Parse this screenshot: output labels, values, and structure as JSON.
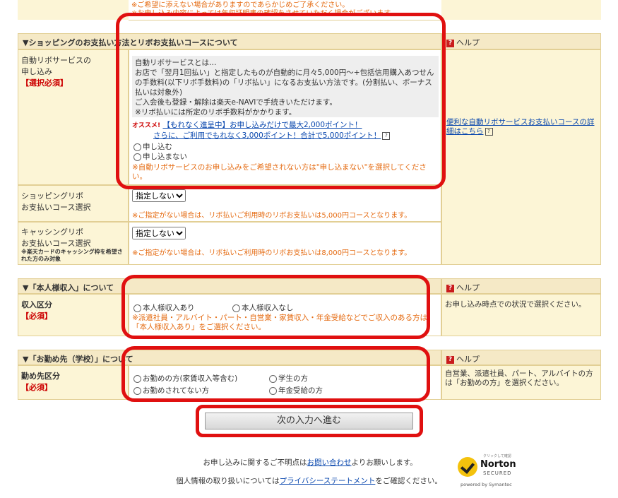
{
  "top_notes": [
    "※ご希望に添えない場合がありますのであらかじめご了承ください。",
    "※お申し込み内容によっては年収証明書の確認をさせていただく場合がございます。"
  ],
  "revo": {
    "header": "▼ショッピングのお支払い方法とリボお支払いコースについて",
    "help_label": "ヘルプ",
    "help_link": "便利な自動リボサービスお支払いコースの詳細はこちら",
    "auto_label_line1": "自動リボサービスの",
    "auto_label_line2": "申し込み",
    "auto_required": "【選択必須】",
    "desc1": "自動リボサービスとは…",
    "desc2": "お店で「翌月1回払い」と指定したものが自動的に月々5,000円～+包括信用購入あつせんの手数料(以下リボ手数料)の「リボ払い」になるお支払い方法です。(分割払い、ボーナス払いは対象外)",
    "desc3": "ご入会後も登録・解除は楽天e-NAVIで手続きいただけます。",
    "desc4": "※リボ払いには所定のリボ手数料がかかります。",
    "osusume": "オススメ!",
    "promo1": "【もれなく進呈中】お申し込みだけで最大2,000ポイント！",
    "promo2": "さらに、ご利用でもれなく3,000ポイント！合計で5,000ポイント！",
    "opt_yes": "申し込む",
    "opt_no": "申し込まない",
    "auto_note": "※自動リボサービスのお申し込みをご希望されない方は\"申し込まない\"を選択してください。",
    "shop_label_line1": "ショッピングリボ",
    "shop_label_line2": "お支払いコース選択",
    "shop_select": "指定しない",
    "shop_note": "※ご指定がない場合は、リボ払いご利用時のリボお支払いは5,000円コースとなります。",
    "cash_label_line1": "キャッシングリボ",
    "cash_label_line2": "お支払いコース選択",
    "cash_small": "※楽天カードのキャッシング枠を希望された方のみ対象",
    "cash_select": "指定しない",
    "cash_note": "※ご指定がない場合は、リボ払いご利用時のリボお支払いは8,000円コースとなります。"
  },
  "income": {
    "header": "▼「本人様収入」について",
    "help_label": "ヘルプ",
    "help_text": "お申し込み時点での状況で選択ください。",
    "label": "収入区分",
    "required": "【必須】",
    "opt1": "本人様収入あり",
    "opt2": "本人様収入なし",
    "note": "※派遣社員・アルバイト・パート・自営業・家賃収入・年金受給などでご収入のある方は「本人様収入あり」をご選択ください。"
  },
  "work": {
    "header": "▼「お勤め先（学校）」について",
    "help_label": "ヘルプ",
    "help_text": "自営業、派遣社員、パート、アルバイトの方は「お勤めの方」を選択ください。",
    "label": "勤め先区分",
    "required": "【必須】",
    "opt1": "お勤めの方(家賃収入等含む)",
    "opt2": "学生の方",
    "opt3": "お勤めされてない方",
    "opt4": "年金受給の方"
  },
  "next_button": "次の入力へ進む",
  "footer": {
    "line1_pre": "お申し込みに関するご不明点は",
    "line1_link": "お問い合わせ",
    "line1_post": "よりお願いします。",
    "line2_pre": "個人情報の取り扱いについては",
    "line2_link": "プライバシーステートメント",
    "line2_post": "をご確認ください。",
    "norton_top": "クリックして確認",
    "norton_name": "Norton",
    "norton_secured": "SECURED",
    "norton_powered": "powered by Symantec"
  }
}
